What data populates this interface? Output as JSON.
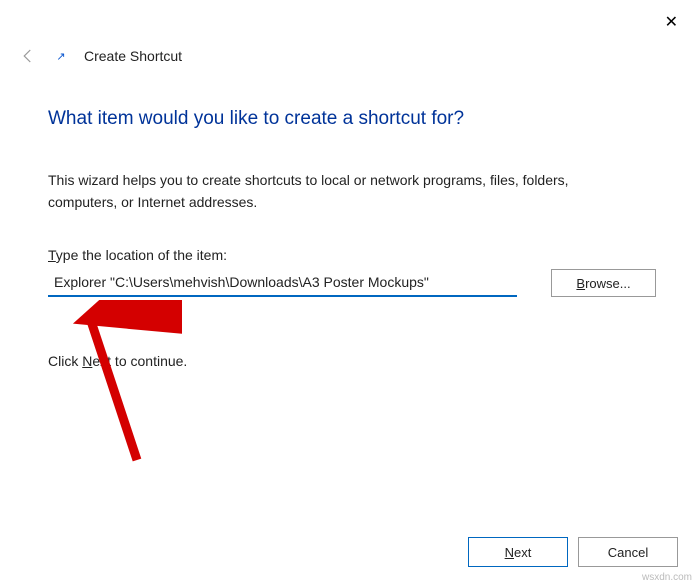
{
  "header": {
    "title": "Create Shortcut"
  },
  "page": {
    "heading": "What item would you like to create a shortcut for?",
    "description": "This wizard helps you to create shortcuts to local or network programs, files, folders, computers, or Internet addresses.",
    "field_label_prefix": "T",
    "field_label_rest": "ype the location of the item:",
    "path_value": "Explorer \"C:\\Users\\mehvish\\Downloads\\A3 Poster Mockups\"",
    "browse_prefix": "B",
    "browse_rest": "rowse...",
    "continue_prefix": "Click ",
    "continue_underline": "N",
    "continue_rest": "ext to continue."
  },
  "footer": {
    "next_underline": "N",
    "next_rest": "ext",
    "cancel": "Cancel"
  },
  "watermark": "wsxdn.com"
}
